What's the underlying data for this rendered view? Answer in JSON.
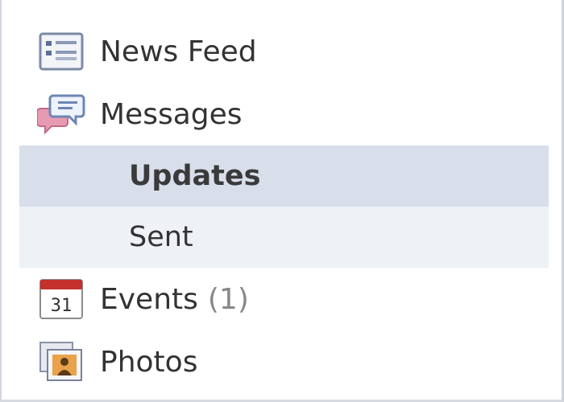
{
  "nav": {
    "news_feed": {
      "label": "News Feed",
      "icon": "news-feed-icon"
    },
    "messages": {
      "label": "Messages",
      "icon": "messages-icon"
    },
    "messages_sub": [
      {
        "label": "Updates",
        "selected": true
      },
      {
        "label": "Sent",
        "selected": false
      }
    ],
    "events": {
      "label": "Events",
      "count": "(1)",
      "icon": "calendar-icon",
      "calendar_day": "31"
    },
    "photos": {
      "label": "Photos",
      "icon": "photos-icon"
    }
  },
  "colors": {
    "selected_bg": "#d8dfea",
    "sub_bg": "#eef1f6",
    "text": "#333333",
    "count": "#888888",
    "calendar_red": "#c4302b"
  }
}
